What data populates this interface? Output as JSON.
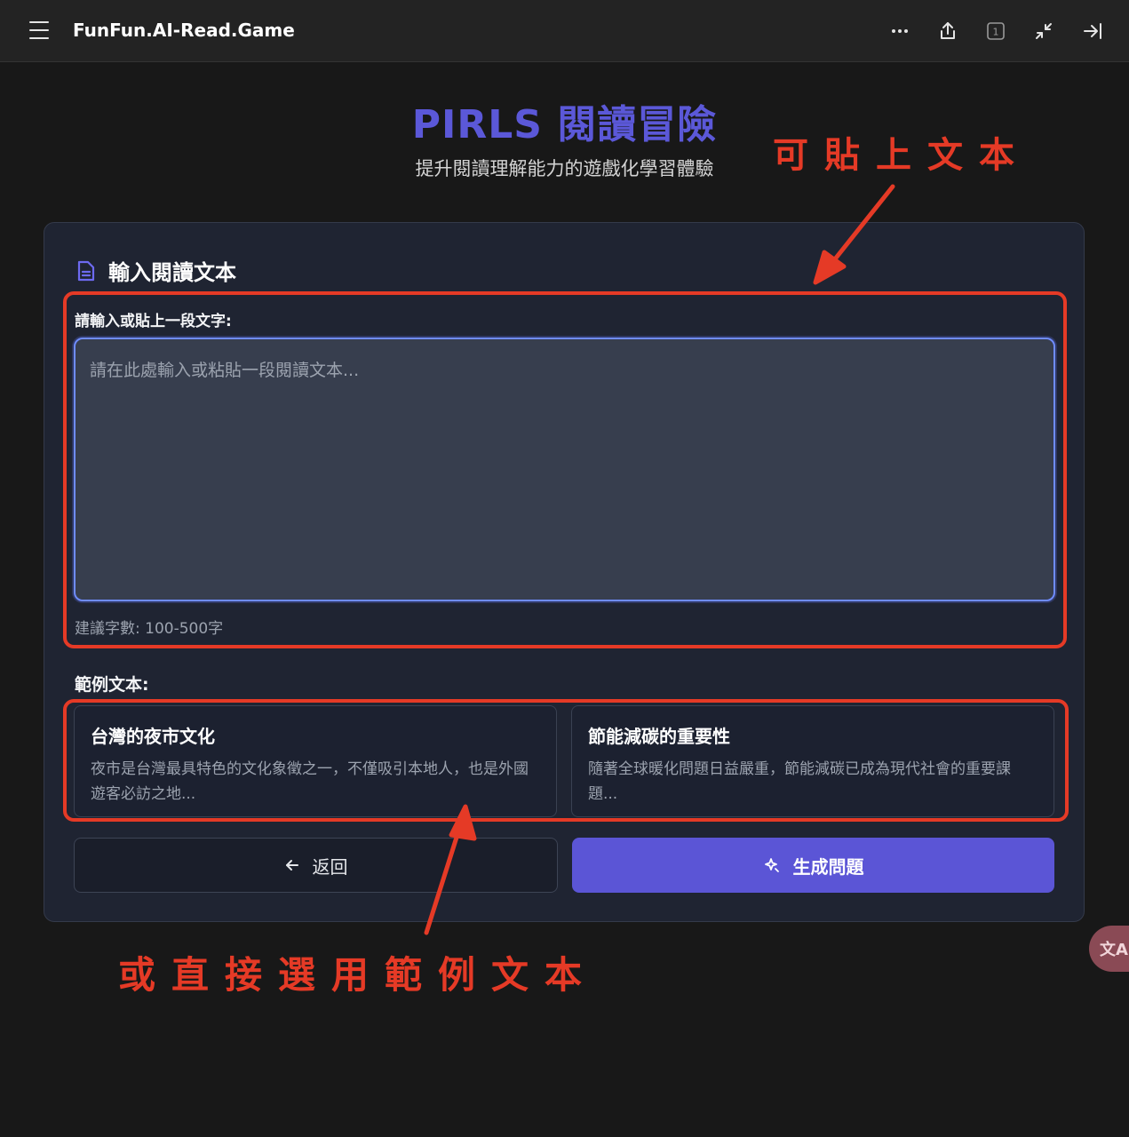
{
  "app": {
    "title": "FunFun.AI-Read.Game",
    "tab_count": "1"
  },
  "hero": {
    "title": "PIRLS 閱讀冒險",
    "subtitle": "提升閱讀理解能力的遊戲化學習體驗"
  },
  "card": {
    "heading": "輸入閱讀文本",
    "field_label": "請輸入或貼上一段文字:",
    "textarea_placeholder": "請在此處輸入或粘貼一段閱讀文本...",
    "textarea_value": "",
    "hint": "建議字數: 100-500字",
    "samples_label": "範例文本:",
    "samples": [
      {
        "title": "台灣的夜市文化",
        "desc": "夜市是台灣最具特色的文化象徵之一，不僅吸引本地人，也是外國遊客必訪之地..."
      },
      {
        "title": "節能減碳的重要性",
        "desc": "隨著全球暖化問題日益嚴重，節能減碳已成為現代社會的重要課題..."
      }
    ],
    "back_label": "返回",
    "generate_label": "生成問題"
  },
  "annotations": {
    "top": "可貼上文本",
    "bottom": "或直接選用範例文本"
  },
  "translate_fab": "文A",
  "colors": {
    "accent": "#5b55d6",
    "annotation": "#e53a26",
    "title": "#5b58d8"
  }
}
